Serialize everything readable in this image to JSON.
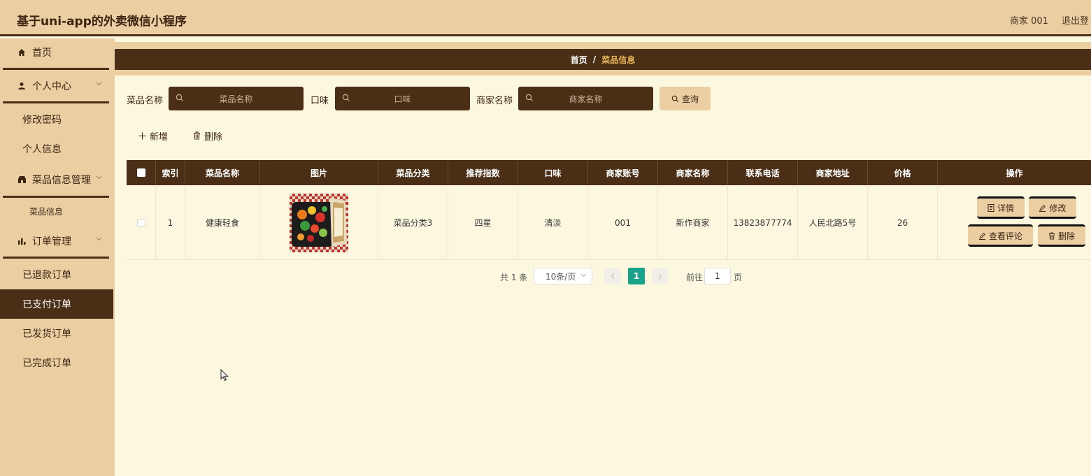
{
  "header": {
    "title": "基于uni-app的外卖微信小程序",
    "user": "商家 001",
    "logout": "退出登"
  },
  "sidebar": {
    "home": "首页",
    "personal_center": "个人中心",
    "change_password": "修改密码",
    "personal_info": "个人信息",
    "dish_management": "菜品信息管理",
    "dish_info": "菜品信息",
    "order_management": "订单管理",
    "refunded_orders": "已退款订单",
    "paid_orders": "已支付订单",
    "shipped_orders": "已发货订单",
    "completed_orders": "已完成订单"
  },
  "breadcrumb": {
    "home": "首页",
    "separator": "/",
    "current": "菜品信息"
  },
  "search": {
    "dish_name_label": "菜品名称",
    "dish_name_placeholder": "菜品名称",
    "taste_label": "口味",
    "taste_placeholder": "口味",
    "merchant_label": "商家名称",
    "merchant_placeholder": "商家名称",
    "query_label": "查询"
  },
  "actions": {
    "add_label": "新增",
    "delete_label": "删除"
  },
  "table": {
    "headers": [
      "索引",
      "菜品名称",
      "图片",
      "菜品分类",
      "推荐指数",
      "口味",
      "商家账号",
      "商家名称",
      "联系电话",
      "商家地址",
      "价格",
      "操作"
    ],
    "rows": [
      {
        "index": "1",
        "dish_name": "健康轻食",
        "category": "菜品分类3",
        "recommend": "四星",
        "taste": "清淡",
        "merchant_account": "001",
        "merchant_name": "新作商家",
        "phone": "13823877774",
        "address": "人民北路5号",
        "price": "26",
        "ops": {
          "detail": "详情",
          "edit": "修改",
          "review": "查看评论",
          "delete": "删除"
        }
      }
    ]
  },
  "pagination": {
    "total": "共 1 条",
    "page_size": "10条/页",
    "current_page": "1",
    "goto_label": "前往",
    "goto_value": "1",
    "page_suffix": "页"
  },
  "colors": {
    "header_bg": "#ebcfa3",
    "dark_brown": "#4a2e15",
    "content_bg": "#fcf7df",
    "pager_active": "#1aa38a",
    "crumb_current": "#e8b85c"
  }
}
